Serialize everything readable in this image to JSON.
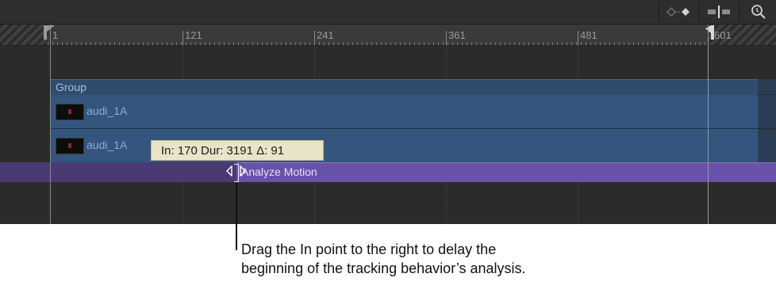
{
  "toolbar": {
    "keyframe_nav_icon": "keyframe-navigation-icon",
    "snap_icon": "snapping-icon",
    "zoom_icon": "zoom-icon"
  },
  "ruler": {
    "labels": [
      "1",
      "121",
      "241",
      "361",
      "481",
      "601"
    ]
  },
  "group": {
    "label": "Group"
  },
  "tracks": [
    {
      "label": "audi_1A"
    },
    {
      "label": "audi_1A"
    }
  ],
  "behavior": {
    "label": "Analyze Motion"
  },
  "tooltip": {
    "text": "In: 170 Dur: 3191 Δ: 91"
  },
  "callout": {
    "line1": "Drag the In point to the right to delay the",
    "line2": "beginning of the tracking behavior’s analysis."
  },
  "colors": {
    "track": "#34557d",
    "behavior": "#6a52a8",
    "tooltip": "#e9e4c8"
  }
}
